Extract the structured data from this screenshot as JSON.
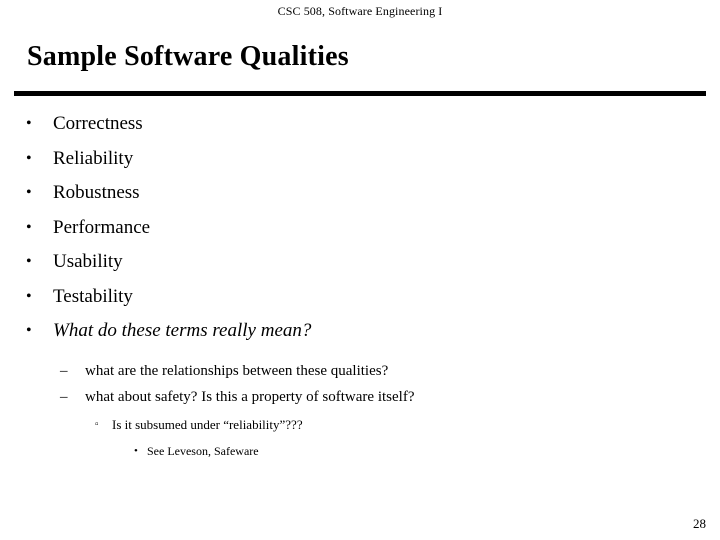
{
  "header": {
    "course": "CSC 508, Software Engineering I"
  },
  "title": "Sample Software Qualities",
  "bullets": {
    "level1_marker": "•",
    "level2_marker": "–",
    "level3_marker": "▫",
    "level4_marker": "•"
  },
  "outline": {
    "level1": [
      {
        "text": "Correctness",
        "italic": false
      },
      {
        "text": "Reliability",
        "italic": false
      },
      {
        "text": "Robustness",
        "italic": false
      },
      {
        "text": "Performance",
        "italic": false
      },
      {
        "text": "Usability",
        "italic": false
      },
      {
        "text": "Testability",
        "italic": false
      },
      {
        "text": "What do these terms really mean?",
        "italic": true
      }
    ],
    "level2": [
      {
        "text": "what are the relationships between these qualities?"
      },
      {
        "text": "what about safety?  Is this a property of software itself?"
      }
    ],
    "level3": [
      {
        "text": "Is it subsumed under “reliability”???"
      }
    ],
    "level4": [
      {
        "text": "See Leveson, Safeware"
      }
    ]
  },
  "footer": {
    "page_number": "28"
  },
  "colors": {
    "background": "#ffffff",
    "text": "#000000",
    "rule": "#000000"
  }
}
